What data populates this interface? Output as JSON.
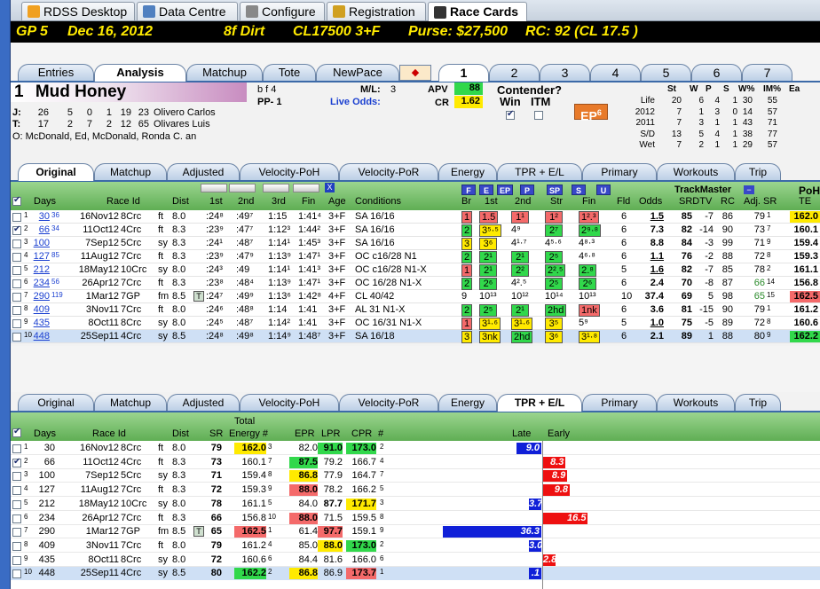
{
  "app_tabs": [
    {
      "label": "RDSS Desktop",
      "icon": "desktop-icon"
    },
    {
      "label": "Data Centre",
      "icon": "database-icon"
    },
    {
      "label": "Configure",
      "icon": "gear-icon"
    },
    {
      "label": "Registration",
      "icon": "key-icon"
    },
    {
      "label": "Race Cards",
      "icon": "document-icon",
      "active": true
    }
  ],
  "race_header": {
    "race": "GP  5",
    "date": "Dec 16, 2012",
    "distance": "8f  Dirt",
    "cond": "CL17500  3+F",
    "purse": "Purse: $27,500",
    "rc": "RC: 92  (CL 17.5 )"
  },
  "top_tabs": [
    "Entries",
    "Analysis",
    "Matchup",
    "Tote",
    "NewPace"
  ],
  "horse_tabs": [
    "1",
    "2",
    "3",
    "4",
    "5",
    "6",
    "7"
  ],
  "horse": {
    "number": "1",
    "name": "Mud Honey",
    "sex_age": "b f 4",
    "pp": "PP- 1",
    "ml_label": "M/L:",
    "ml": "3",
    "live_odds": "Live Odds:",
    "apv_label": "APV",
    "apv": "88",
    "cr_label": "CR",
    "cr": "1.62",
    "contender": "Contender?",
    "win": "Win",
    "itm": "ITM",
    "ep": "EP",
    "ep_val": "6",
    "jockey": {
      "label": "J:",
      "stats": [
        "26",
        "5",
        "0",
        "1",
        "19",
        "23"
      ],
      "name": "Olivero Carlos"
    },
    "trainer": {
      "label": "T:",
      "stats": [
        "17",
        "2",
        "7",
        "2",
        "12",
        "65"
      ],
      "name": "Olivares Luis"
    },
    "owner": "O:  McDonald, Ed, McDonald, Ronda C. an"
  },
  "record": {
    "headers": [
      "St",
      "W",
      "P",
      "S",
      "W%",
      "IM%",
      "Ea"
    ],
    "rows": [
      [
        "Life",
        "20",
        "6",
        "4",
        "1",
        "30",
        "55"
      ],
      [
        "2012",
        "7",
        "1",
        "3",
        "0",
        "14",
        "57"
      ],
      [
        "2011",
        "7",
        "3",
        "1",
        "1",
        "43",
        "71"
      ],
      [
        "S/D",
        "13",
        "5",
        "4",
        "1",
        "38",
        "77"
      ],
      [
        "Wet",
        "7",
        "2",
        "1",
        "1",
        "29",
        "57"
      ]
    ]
  },
  "sub_tabs1": [
    "Original",
    "Matchup",
    "Adjusted",
    "Velocity-PoH",
    "Velocity-PoR",
    "Energy",
    "TPR + E/L",
    "Primary",
    "Workouts",
    "Trip"
  ],
  "sub_tabs2": [
    "Original",
    "Matchup",
    "Adjusted",
    "Velocity-PoH",
    "Velocity-PoR",
    "Energy",
    "TPR + E/L",
    "Primary",
    "Workouts",
    "Trip"
  ],
  "grid1": {
    "headers": {
      "days": "Days",
      "race": "Race Id",
      "dist": "Dist",
      "c1": "1st",
      "c2": "2nd",
      "c3": "3rd",
      "fin": "Fin",
      "age": "Age",
      "cond": "Conditions",
      "br": "Br",
      "s1": "1st",
      "s2": "2nd",
      "str": "Str",
      "fin2": "Fin",
      "fld": "Fld",
      "odds": "Odds",
      "tm": "TrackMaster",
      "srdtv": "SRDTV",
      "rc": "RC",
      "adjsr": "Adj. SR",
      "poh": "PoH",
      "te": "TE"
    },
    "pace_btns": [
      "F",
      "E",
      "EP",
      "P",
      "SP",
      "S",
      "U"
    ],
    "rows": [
      [
        "1",
        "30",
        "36",
        "16Nov12",
        "8Crc",
        "ft",
        "8.0",
        ":24⁸",
        ":49⁷",
        "1:15",
        "1:41⁴",
        "3+F",
        "SA 16/16",
        "1",
        "1.5",
        "1¹",
        "1²",
        "1².³",
        "6",
        "1.5",
        "85",
        "-7",
        "86",
        "79",
        "1",
        "162.0"
      ],
      [
        "2",
        "66",
        "34",
        "11Oct12",
        "4Crc",
        "ft",
        "8.3",
        ":23⁹",
        ":47⁷",
        "1:12³",
        "1:44²",
        "3+F",
        "SA 16/16",
        "2",
        "3⁵·⁵",
        "4⁹",
        "2⁷",
        "2⁹·⁸",
        "6",
        "7.3",
        "82",
        "-14",
        "90",
        "73",
        "7",
        "160.1"
      ],
      [
        "3",
        "100",
        "",
        "7Sep12",
        "5Crc",
        "sy",
        "8.3",
        ":24¹",
        ":48⁷",
        "1:14¹",
        "1:45³",
        "3+F",
        "SA 16/16",
        "3",
        "3⁶",
        "4¹·⁷",
        "4⁵·⁶",
        "4⁸·³",
        "6",
        "8.8",
        "84",
        "-3",
        "99",
        "71",
        "9",
        "159.4"
      ],
      [
        "4",
        "127",
        "85",
        "11Aug12",
        "7Crc",
        "ft",
        "8.3",
        ":23⁹",
        ":47⁹",
        "1:13⁹",
        "1:47¹",
        "3+F",
        "OC c16/28 N1",
        "2",
        "2¹",
        "2¹",
        "2⁵",
        "4⁶·⁸",
        "6",
        "1.1",
        "76",
        "-2",
        "88",
        "72",
        "8",
        "159.3"
      ],
      [
        "5",
        "212",
        "",
        "18May12",
        "10Crc",
        "sy",
        "8.0",
        ":24³",
        ":49",
        "1:14¹",
        "1:41³",
        "3+F",
        "OC c16/28 N1-X",
        "1",
        "2¹",
        "2²",
        "2².⁵",
        "2.⁸",
        "5",
        "1.6",
        "82",
        "-7",
        "85",
        "78",
        "2",
        "161.1"
      ],
      [
        "6",
        "234",
        "56",
        "26Apr12",
        "7Crc",
        "ft",
        "8.3",
        ":23⁸",
        ":48⁴",
        "1:13⁹",
        "1:47¹",
        "3+F",
        "OC 16/28 N1-X",
        "2",
        "2⁶",
        "4².⁵",
        "2⁵",
        "2⁶",
        "6",
        "2.4",
        "70",
        "-8",
        "87",
        "66",
        "14",
        "156.8"
      ],
      [
        "7",
        "290",
        "119",
        "1Mar12",
        "7GP",
        "fm",
        "8.5",
        ":24⁷",
        ":49⁹",
        "1:13⁶",
        "1:42⁸",
        "4+F",
        "CL 40/42",
        "9",
        "10¹³",
        "10¹²",
        "10¹⁴",
        "10¹³",
        "10",
        "37.4",
        "69",
        "5",
        "98",
        "65",
        "15",
        "162.5"
      ],
      [
        "8",
        "409",
        "",
        "3Nov11",
        "7Crc",
        "ft",
        "8.0",
        ":24⁶",
        ":48⁸",
        "1:14",
        "1:41",
        "3+F",
        "AL 31 N1-X",
        "2",
        "2⁵",
        "2¹",
        "2hd",
        "1nk",
        "6",
        "3.6",
        "81",
        "-15",
        "90",
        "79",
        "1",
        "161.2"
      ],
      [
        "9",
        "435",
        "",
        "8Oct11",
        "8Crc",
        "sy",
        "8.0",
        ":24⁵",
        ":48⁷",
        "1:14²",
        "1:41",
        "3+F",
        "OC 16/31 N1-X",
        "1",
        "3¹·⁶",
        "3¹·⁶",
        "3⁵",
        "5⁹",
        "5",
        "1.0",
        "75",
        "-5",
        "89",
        "72",
        "8",
        "160.6"
      ],
      [
        "10",
        "448",
        "",
        "25Sep11",
        "4Crc",
        "sy",
        "8.5",
        ":24⁸",
        ":49⁸",
        "1:14⁹",
        "1:48⁷",
        "3+F",
        "SA 16/18",
        "3",
        "3nk",
        "2hd",
        "3⁶",
        "3¹·⁸",
        "6",
        "2.1",
        "89",
        "1",
        "88",
        "80",
        "9",
        "162.2"
      ]
    ]
  },
  "grid2": {
    "headers": {
      "days": "Days",
      "race": "Race Id",
      "dist": "Dist",
      "sr": "SR",
      "total": "Total",
      "energy": "Energy #",
      "epr": "EPR",
      "lpr": "LPR",
      "cpr": "CPR",
      "hash": "#",
      "late": "Late",
      "early": "Early"
    },
    "rows": [
      [
        "1",
        "30",
        "16Nov12",
        "8Crc",
        "ft",
        "8.0",
        "",
        "79",
        "162.0",
        "3",
        "82.0",
        "91.0",
        "173.0",
        "2",
        "9.0",
        "late"
      ],
      [
        "2",
        "66",
        "11Oct12",
        "4Crc",
        "ft",
        "8.3",
        "",
        "73",
        "160.1",
        "7",
        "87.5",
        "79.2",
        "166.7",
        "4",
        "8.3",
        "early"
      ],
      [
        "3",
        "100",
        "7Sep12",
        "5Crc",
        "sy",
        "8.3",
        "",
        "71",
        "159.4",
        "8",
        "86.8",
        "77.9",
        "164.7",
        "7",
        "8.9",
        "early"
      ],
      [
        "4",
        "127",
        "11Aug12",
        "7Crc",
        "ft",
        "8.3",
        "",
        "72",
        "159.3",
        "9",
        "88.0",
        "78.2",
        "166.2",
        "5",
        "9.8",
        "early"
      ],
      [
        "5",
        "212",
        "18May12",
        "10Crc",
        "sy",
        "8.0",
        "",
        "78",
        "161.1",
        "5",
        "84.0",
        "87.7",
        "171.7",
        "3",
        "3.7",
        "late"
      ],
      [
        "6",
        "234",
        "26Apr12",
        "7Crc",
        "ft",
        "8.3",
        "",
        "66",
        "156.8",
        "10",
        "88.0",
        "71.5",
        "159.5",
        "8",
        "16.5",
        "early"
      ],
      [
        "7",
        "290",
        "1Mar12",
        "7GP",
        "fm",
        "8.5",
        "T",
        "65",
        "162.5",
        "1",
        "61.4",
        "97.7",
        "159.1",
        "9",
        "36.3",
        "late"
      ],
      [
        "8",
        "409",
        "3Nov11",
        "7Crc",
        "ft",
        "8.0",
        "",
        "79",
        "161.2",
        "4",
        "85.0",
        "88.0",
        "173.0",
        "2",
        "3.0",
        "late"
      ],
      [
        "9",
        "435",
        "8Oct11",
        "8Crc",
        "sy",
        "8.0",
        "",
        "72",
        "160.6",
        "6",
        "84.4",
        "81.6",
        "166.0",
        "6",
        "2.8",
        "early"
      ],
      [
        "10",
        "448",
        "25Sep11",
        "4Crc",
        "sy",
        "8.5",
        "",
        "80",
        "162.2",
        "2",
        "86.8",
        "86.9",
        "173.7",
        "1",
        ".1",
        "late"
      ]
    ]
  }
}
